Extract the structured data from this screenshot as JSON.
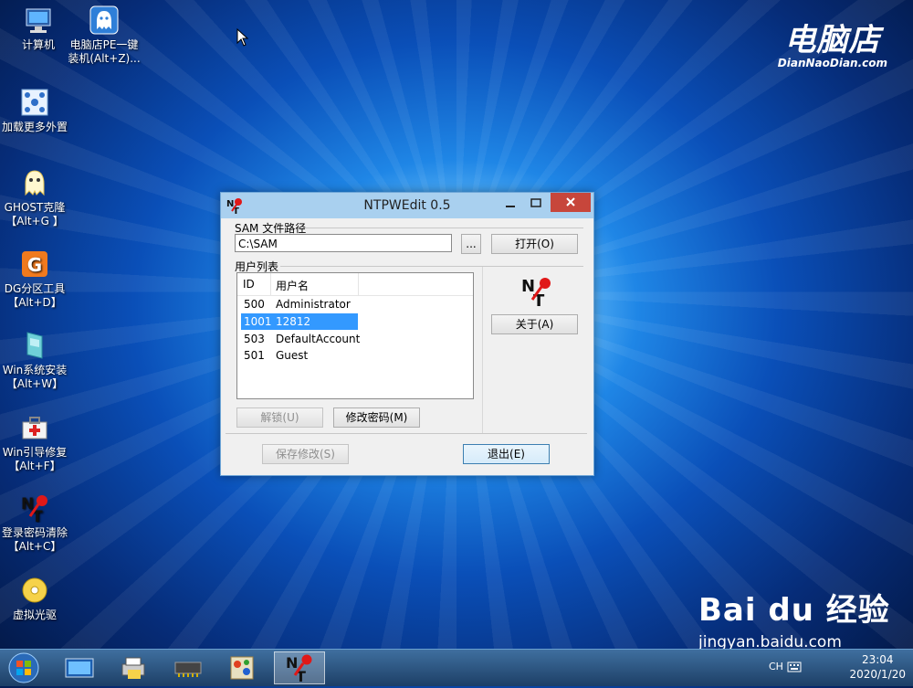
{
  "desktop": {
    "icons": [
      {
        "label": "计算机",
        "icon": "computer-icon"
      },
      {
        "label": "电脑店PE一键\n装机(Alt+Z)...",
        "icon": "ghost-installer-icon"
      },
      {
        "label": "加载更多外置",
        "icon": "load-external-icon"
      },
      {
        "label": "GHOST克隆\n【Alt+G 】",
        "icon": "ghost-icon"
      },
      {
        "label": "DG分区工具\n【Alt+D】",
        "icon": "diskgenius-icon"
      },
      {
        "label": "Win系统安装\n【Alt+W】",
        "icon": "windows-install-icon"
      },
      {
        "label": "Win引导修复\n【Alt+F】",
        "icon": "boot-repair-icon"
      },
      {
        "label": "登录密码清除\n【Alt+C】",
        "icon": "password-clear-icon"
      },
      {
        "label": "虚拟光驱",
        "icon": "virtual-drive-icon"
      }
    ],
    "brand": {
      "name": "电脑店",
      "url": "DianNaoDian.com"
    },
    "watermark": {
      "line1": "Bai du 经验",
      "line2": "jingyan.baidu.com"
    }
  },
  "window": {
    "title": "NTPWEdit 0.5",
    "sam_label": "SAM 文件路径",
    "sam_path": "C:\\SAM",
    "browse_label": "...",
    "open_label": "打开(O)",
    "userlist_label": "用户列表",
    "columns": [
      "ID",
      "用户名"
    ],
    "users": [
      {
        "id": "500",
        "name": "Administrator",
        "selected": false
      },
      {
        "id": "1001",
        "name": "12812",
        "selected": true
      },
      {
        "id": "503",
        "name": "DefaultAccount",
        "selected": false
      },
      {
        "id": "501",
        "name": "Guest",
        "selected": false
      }
    ],
    "about_label": "关于(A)",
    "unlock_label": "解锁(U)",
    "change_pw_label": "修改密码(M)",
    "save_label": "保存修改(S)",
    "exit_label": "退出(E)"
  },
  "taskbar": {
    "ime": "CH",
    "time": "23:04",
    "date": "2020/1/20"
  },
  "colors": {
    "selection": "#3399ff",
    "close_button": "#c7463b",
    "titlebar": "#a9d0ef"
  }
}
